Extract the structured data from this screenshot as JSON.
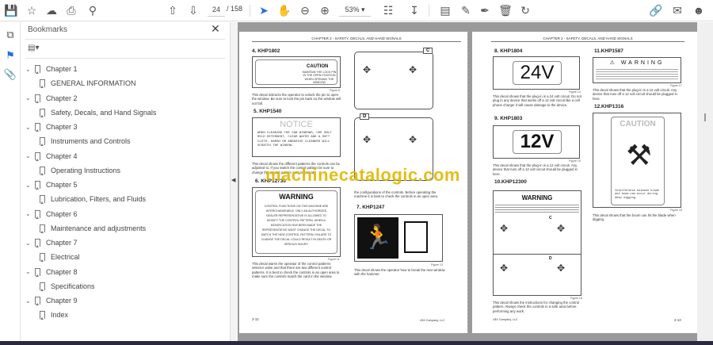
{
  "toolbar": {
    "page_current": "24",
    "page_total": "/ 158",
    "zoom": "53%",
    "icons": [
      "save-icon",
      "star-icon",
      "cloud-upload-icon",
      "print-icon",
      "search-icon",
      "page-up-icon",
      "page-down-icon",
      "select-cursor-icon",
      "hand-icon",
      "zoom-out-icon",
      "zoom-in-icon",
      "fit-page-icon",
      "scroll-mode-icon",
      "comment-icon",
      "highlight-pen-icon",
      "sign-icon",
      "delete-icon",
      "rotate-icon",
      "share-link-icon",
      "email-icon",
      "account-icon"
    ]
  },
  "sidebar": {
    "title": "Bookmarks",
    "items": [
      {
        "label": "Chapter 1",
        "level": 0
      },
      {
        "label": "GENERAL INFORMATION",
        "level": 1
      },
      {
        "label": "Chapter 2",
        "level": 0
      },
      {
        "label": "Safety, Decals, and Hand Signals",
        "level": 1
      },
      {
        "label": "Chapter 3",
        "level": 0
      },
      {
        "label": "Instruments and Controls",
        "level": 1
      },
      {
        "label": "Chapter 4",
        "level": 0
      },
      {
        "label": "Operating Instructions",
        "level": 1
      },
      {
        "label": "Chapter 5",
        "level": 0
      },
      {
        "label": "Lubrication, Filters, and Fluids",
        "level": 1
      },
      {
        "label": "Chapter 6",
        "level": 0
      },
      {
        "label": "Maintenance and adjustments",
        "level": 1
      },
      {
        "label": "Chapter 7",
        "level": 0
      },
      {
        "label": "Electrical",
        "level": 1
      },
      {
        "label": "Chapter 8",
        "level": 0
      },
      {
        "label": "Specifications",
        "level": 1
      },
      {
        "label": "Chapter 9",
        "level": 0
      },
      {
        "label": "Index",
        "level": 1
      }
    ]
  },
  "document": {
    "header": "CHAPTER 2 - SAFETY, DECALS, AND HAND SIGNALS",
    "watermark": "machinecatalogic.com",
    "left_page": {
      "s4_title": "4. KHP1802",
      "s4_decal_caution": "CAUTION",
      "s4_decal_text": "MAINTAIN THE LOCK PIN IN THE OPEN POSITION WHEN OPENING THE WINDOW",
      "s4_fig": "Figure 8",
      "s4_text": "This decal instructs the operator to unlock the pin to open the window. Be sure to lock the pin back so the window will not fall.",
      "s5_title": "5. KHP1540",
      "s5_notice": "NOTICE",
      "s5_decal_text": "WHEN CLEANING THE CAB WINDOWS, USE ONLY MILD DETERGENT, CLEAR WATER AND A SOFT CLOTH. HARSH OR ABRASIVE CLEANERS WILL SCRATCH THE WINDOW.",
      "s5_text": "This decal shows the different patterns the controls can be adjusted to. If you switch the control pattern be sure to change the control pattern card in the cab.",
      "s6_title": "6. KHP12730",
      "s6_warning": "WARNING",
      "s6_decal_text": "CONTROL FUNCTIONS ON THIS MACHINE ARE INTERCHANGEABLE. ONLY AN AUTHORIZED DEALER REPRESENTATIVE IS ALLOWED TO MODIFY THE CONTROL PATTERN. WHEN A MODIFICATION HAS BEEN MADE THE REPRESENTATIVE MUST CHANGE THE DECAL TO MATCH THE NEW CONTROL PATTERN. FAILURE TO CHANGE THE DECAL COULD RESULT IN DEATH OR SERIOUS INJURY.",
      "s6_fig": "Figure 11",
      "s6_text": "This decal warns the operator of the control patterns selector valve and that there are two different control patterns. It is best to check the controls in an open area to make sure the controls match the card in the window.",
      "pattern_c": "C",
      "pattern_d": "D",
      "pattern_text": "the configurations of the controls. Before operating the machine it is best to check the controls in an open area.",
      "s7_title": "7. KHP1247",
      "s7_fig": "Figure 13",
      "s7_text": "This decal shows the operator how to break the rear window with the hammer.",
      "footer_page": "2-12",
      "footer_company": "LBX Company, LLC"
    },
    "right_page": {
      "s8_title": "8. KHP1804",
      "s8_decal": "24V",
      "s8_fig": "Figure 14",
      "s8_text": "This decal shows that the plug-in is a 24 volt circuit. Do not plug in any device that works off a 12 volt circuit like a cell phone charger it will cause damage to the device.",
      "s9_title": "9. KHP1803",
      "s9_decal": "12V",
      "s9_fig": "Figure 15",
      "s9_text": "This decal shows that the plug-in is a 12 volt circuit. Any device that runs off a 12 volt circuit should be plugged in here.",
      "s10_title": "10.KHP12300",
      "s10_warning": "WARNING",
      "s10_pattern_c": "C",
      "s10_pattern_d": "D",
      "s10_fig": "Figure 16",
      "s10_text": "This decal shows the instructions for changing the control pattern. Always check the controls in a safe area before performing any work.",
      "s11_title": "11.KHP1587",
      "s11_warning": "WARNING",
      "s11_fig": "Figure 17",
      "s11_text": "This decal shows that the plug-in is a 12 volt circuit. Any device that runs off a 12 volt circuit should be plugged in here.",
      "s12_title": "12.KHP1316",
      "s12_caution": "CAUTION",
      "s12_decal_text": "Interference between blade and boom can occur during deep digging.",
      "s12_fig": "Figure 18",
      "s12_text": "This decal shows that the boom can hit the blade when digging.",
      "footer_company": "LBX Company, LLC",
      "footer_page": "2-13"
    }
  }
}
